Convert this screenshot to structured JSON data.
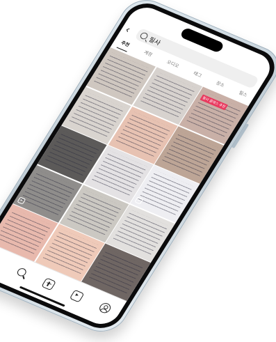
{
  "search": {
    "query": "필사"
  },
  "tabs": [
    {
      "label": "추천",
      "active": true
    },
    {
      "label": "계정",
      "active": false
    },
    {
      "label": "오디오",
      "active": false
    },
    {
      "label": "태그",
      "active": false
    },
    {
      "label": "장소",
      "active": false
    },
    {
      "label": "릴스",
      "active": false
    }
  ],
  "grid": {
    "items": [
      {
        "content": "handwritten-notebook-page",
        "tone": "#cfc7c0",
        "reel": false
      },
      {
        "content": "notebook-with-sticky-note",
        "tone": "#d7d2ce",
        "reel": false
      },
      {
        "content": "pink-sweater-and-book",
        "tone": "#c9b0a7",
        "reel": false,
        "label": "필사 클래스 추천"
      },
      {
        "content": "open-planner-pages",
        "tone": "#d9d4cf",
        "reel": false
      },
      {
        "content": "peach-paper-sheet",
        "tone": "#e7c2b2",
        "reel": false
      },
      {
        "content": "book-page-photo",
        "tone": "#bda596",
        "reel": false
      },
      {
        "content": "dark-desk-photo",
        "tone": "#5c5a59",
        "reel": false
      },
      {
        "content": "lined-notebook",
        "tone": "#e4e2e4",
        "reel": false
      },
      {
        "content": "spiral-notebook-writing",
        "tone": "#eeeef2",
        "reel": true
      },
      {
        "content": "grey-paper-writing",
        "tone": "#8f8d8b",
        "reel": true
      },
      {
        "content": "manuscript-paper",
        "tone": "#cbc8c2",
        "reel": false
      },
      {
        "content": "card-and-note",
        "tone": "#e2e0de",
        "reel": false
      },
      {
        "content": "pink-grid-paper",
        "tone": "#e8b9ad",
        "reel": false
      },
      {
        "content": "peach-writing-paper",
        "tone": "#efcab9",
        "reel": false
      },
      {
        "content": "dark-book-cover",
        "tone": "#6f6663",
        "reel": false
      }
    ]
  },
  "bottom_nav": [
    {
      "icon": "home-icon"
    },
    {
      "icon": "search-icon"
    },
    {
      "icon": "create-icon"
    },
    {
      "icon": "reels-icon"
    },
    {
      "icon": "profile-icon"
    }
  ]
}
